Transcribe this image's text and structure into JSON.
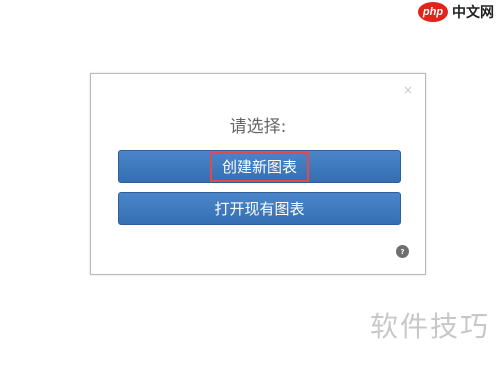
{
  "logo": {
    "badge": "php",
    "text": "中文网"
  },
  "dialog": {
    "close_icon": "×",
    "prompt": "请选择:",
    "buttons": {
      "create": "创建新图表",
      "open": "打开现有图表"
    },
    "help_icon": "?"
  },
  "watermark": "软件技巧",
  "colors": {
    "button_blue": "#3d7abf",
    "highlight_red": "#e24a4a",
    "logo_red": "#e2231a"
  }
}
